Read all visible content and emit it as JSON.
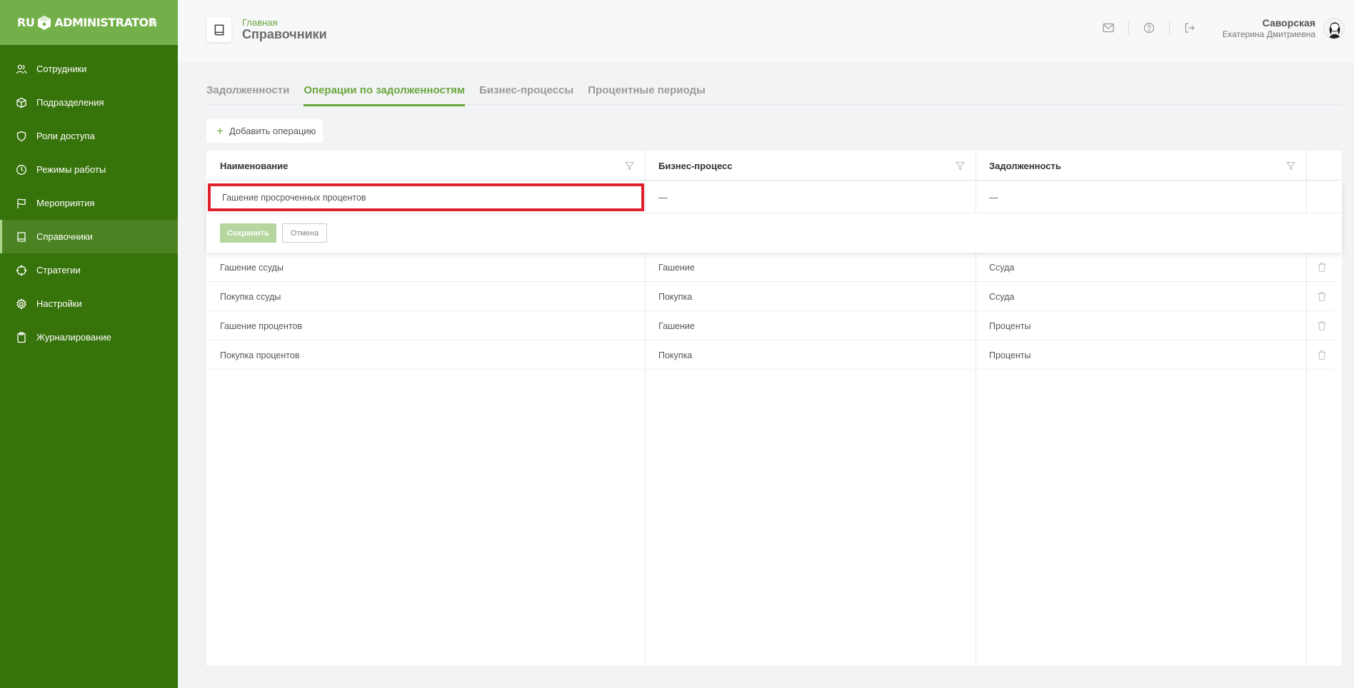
{
  "logo": {
    "left": "RU",
    "right": "ADMINISTRATOR"
  },
  "colors": {
    "sidebar": "#37730b",
    "sidebar_head": "#74b04a",
    "accent": "#6aa73d",
    "highlight": "#e0202a"
  },
  "sidebar": {
    "items": [
      {
        "label": "Сотрудники",
        "icon": "users-icon"
      },
      {
        "label": "Подразделения",
        "icon": "cube-icon"
      },
      {
        "label": "Роли доступа",
        "icon": "shield-icon"
      },
      {
        "label": "Режимы работы",
        "icon": "clock-icon"
      },
      {
        "label": "Мероприятия",
        "icon": "flag-icon"
      },
      {
        "label": "Справочники",
        "icon": "book-icon",
        "active": true
      },
      {
        "label": "Стратегии",
        "icon": "crosshair-icon"
      },
      {
        "label": "Настройки",
        "icon": "gear-icon"
      },
      {
        "label": "Журналирование",
        "icon": "clipboard-icon"
      }
    ]
  },
  "header": {
    "breadcrumb": "Главная",
    "title": "Справочники",
    "user_last": "Саворская",
    "user_first": "Екатерина Дмитриевна"
  },
  "tabs": [
    {
      "label": "Задолженности",
      "active": false
    },
    {
      "label": "Операции по задолженностям",
      "active": true
    },
    {
      "label": "Бизнес-процессы",
      "active": false
    },
    {
      "label": "Процентные периоды",
      "active": false
    }
  ],
  "add_button": "Добавить операцию",
  "table": {
    "columns": [
      "Наименование",
      "Бизнес-процесс",
      "Задолженность"
    ],
    "edit_row": {
      "name": "Гашение просроченных процентов",
      "process": "—",
      "debt": "—",
      "save": "Сохранить",
      "cancel": "Отмена"
    },
    "rows": [
      {
        "name": "Гашение ссуды",
        "process": "Гашение",
        "debt": "Ссуда"
      },
      {
        "name": "Покупка ссуды",
        "process": "Покупка",
        "debt": "Ссуда"
      },
      {
        "name": "Гашение процентов",
        "process": "Гашение",
        "debt": "Проценты"
      },
      {
        "name": "Покупка процентов",
        "process": "Покупка",
        "debt": "Проценты"
      }
    ]
  }
}
